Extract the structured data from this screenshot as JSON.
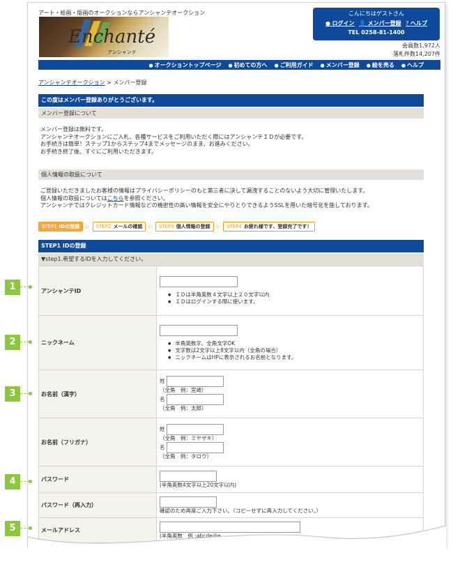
{
  "header": {
    "tagline": "アート・絵画・版画のオークションならアンシャンテオークション",
    "logo_text": "Enchanté",
    "logo_kana": "アンシャンテ",
    "greeting": "こんにちはゲストさん",
    "login": "ログイン",
    "member_register": "メンバー登録",
    "help": "ヘルプ",
    "tel": "TEL 0258-81-1400",
    "member_count": "会員数1,972人",
    "bid_count": "落札件数14,207件"
  },
  "nav": {
    "items": [
      "オークショントップページ",
      "初めての方へ",
      "ご利用ガイド",
      "メンバー登録",
      "絵を売る",
      "ヘルプ"
    ]
  },
  "breadcrumb": {
    "home": "アンシャンテオークション",
    "sep": " > ",
    "current": "メンバー登録"
  },
  "thanks_title": "この度はメンバー登録ありがとうございます。",
  "about_section": {
    "title": "メンバー登録について",
    "lines": [
      "メンバー登録は無料です。",
      "アンシャンテオークションにご入札、各種サービスをご利用いただく際にはアンシャンテＩＤが必要です。",
      "お手続きは簡単！ステップ1からステップ4までメッセージのまま、お進みください。",
      "お手続き終了後、すぐにご利用いただきます。"
    ]
  },
  "privacy_section": {
    "title": "個人情報の取扱について",
    "line1": "ご登録いただきましたお客様の情報はプライバシーポリシーのもと第三者に決して漏洩することのないよう大切に管理いたします。",
    "line2_pre": "個人情報の取扱については",
    "line2_link": "こちら",
    "line2_post": "を参照ください。",
    "line3": "アンシャンテではクレジットカード情報などの機密性の高い情報を安全にやりとりできるようSSLを用いた暗号化を施しております。"
  },
  "steps": [
    {
      "num": "STEP1",
      "label": "IDの登録"
    },
    {
      "num": "STEP2",
      "label": "メールの確認"
    },
    {
      "num": "STEP3",
      "label": "個人情報の登録"
    },
    {
      "num": "STEP4",
      "label": "お疲れ様です、登録完了です！"
    }
  ],
  "step1": {
    "title": "STEP1 IDの登録",
    "subtitle": "▼step1.希望するIDを入力してください。"
  },
  "form": {
    "id_label": "アンシャンテID",
    "id_notes": [
      "ＩＤは半角英数４文字以上２０文字以内",
      "ＩＤはログインする際に使います。"
    ],
    "nick_label": "ニックネーム",
    "nick_notes": [
      "半角英数字、全角文字OK",
      "文字数は2文字以上8文字以内（全角の場合）",
      "ニックネームはHPに表示されるお名前となります。"
    ],
    "name_kanji_label": "お名前（漢字）",
    "sei": "姓",
    "mei": "名",
    "kanji_sei_hint": "（全角　例：宮崎）",
    "kanji_mei_hint": "（全角　例：太郎）",
    "name_kana_label": "お名前（フリガナ）",
    "kana_sei_hint": "（全角　例：ミヤザキ）",
    "kana_mei_hint": "（全角　例：タロウ）",
    "password_label": "パスワード",
    "password_hint": "(半角英数4文字以上20文字以内)",
    "password_confirm_label": "パスワード（再入力）",
    "password_confirm_hint": "確認のため再度ご入力下さい。（コピーせずに再入力してください。）",
    "email_label": "メールアドレス",
    "email_hint": "(半角英数　例 :abcde@e"
  },
  "badges": [
    "1",
    "2",
    "3",
    "4",
    "5"
  ],
  "colors": {
    "nav_blue": "#0f4a9a",
    "step_orange": "#f29c1f",
    "badge_green": "#8dc63f"
  }
}
